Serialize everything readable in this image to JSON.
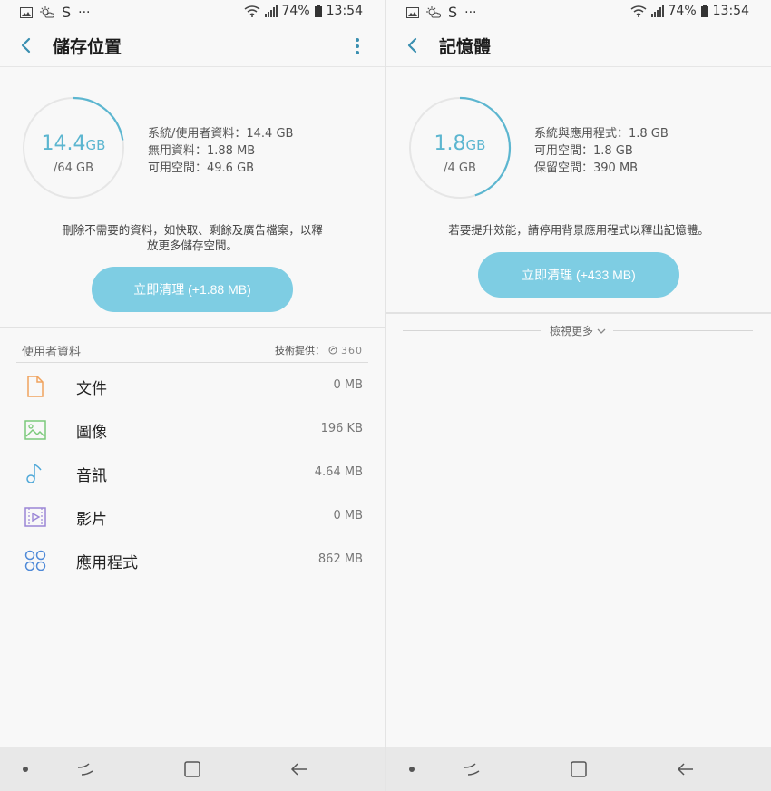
{
  "status": {
    "battery": "74%",
    "time": "13:54"
  },
  "storage": {
    "title": "儲存位置",
    "used_value": "14.4",
    "used_unit": "GB",
    "total": "/64 GB",
    "used_fraction": 0.225,
    "info": [
      "系統/使用者資料：14.4 GB",
      "無用資料：1.88 MB",
      "可用空間：49.6 GB"
    ],
    "hint_line1": "刪除不需要的資料，如快取、剩餘及廣告檔案，以釋",
    "hint_line2": "放更多儲存空間。",
    "clean_label": "立即清理 (+1.88 MB)",
    "section_title": "使用者資料",
    "provider_label": "技術提供：",
    "provider_logo": "360",
    "items": [
      {
        "label": "文件",
        "size": "0 MB",
        "icon": "document-icon",
        "color": "#f0a35e"
      },
      {
        "label": "圖像",
        "size": "196 KB",
        "icon": "image-icon",
        "color": "#7bc97a"
      },
      {
        "label": "音訊",
        "size": "4.64 MB",
        "icon": "music-note-icon",
        "color": "#4fa8d8"
      },
      {
        "label": "影片",
        "size": "0 MB",
        "icon": "video-icon",
        "color": "#9b86d6"
      },
      {
        "label": "應用程式",
        "size": "862 MB",
        "icon": "apps-icon",
        "color": "#4f8ad8"
      }
    ]
  },
  "memory": {
    "title": "記憶體",
    "used_value": "1.8",
    "used_unit": "GB",
    "total": "/4 GB",
    "used_fraction": 0.45,
    "info": [
      "系統與應用程式：1.8 GB",
      "可用空間：1.8 GB",
      "保留空間：390 MB"
    ],
    "hint": "若要提升效能，請停用背景應用程式以釋出記憶體。",
    "clean_label": "立即清理 (+433 MB)",
    "view_more": "檢視更多"
  },
  "colors": {
    "accent": "#5cb6d0",
    "button": "#7ecde3",
    "ring_track": "#e6e6e6"
  }
}
